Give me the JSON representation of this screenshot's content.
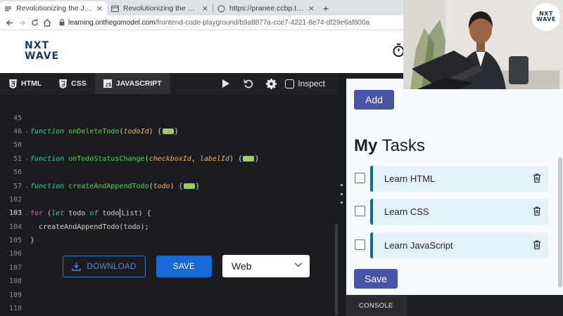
{
  "browser": {
    "tabs": [
      {
        "title": "Revolutionizing the Job M",
        "active": true
      },
      {
        "title": "Revolutionizing the Job M",
        "active": false
      },
      {
        "title": "https://pranee.ccbp.tech",
        "active": false
      }
    ],
    "url_host": "learning.onthegomodel.com",
    "url_path": "/frontend-code-playground/b9a8877a-cce7-4221-8e74-df29e6af800a"
  },
  "brand": {
    "line1": "NXT",
    "line2": "WAVE"
  },
  "editor": {
    "tabs": [
      {
        "label": "HTML",
        "icon": "html5-icon"
      },
      {
        "label": "CSS",
        "icon": "css3-icon"
      },
      {
        "label": "JAVASCRIPT",
        "icon": "js-icon"
      }
    ],
    "inspect_label": "Inspect",
    "line_numbers": {
      "l45": "45",
      "l46": "46",
      "l50": "50",
      "l51": "51",
      "l56": "56",
      "l57": "57",
      "l102": "102",
      "l103": "103",
      "l104": "104",
      "l105": "105",
      "l106": "106",
      "l107": "107",
      "l108": "108",
      "l109": "109",
      "l110": "110"
    },
    "tokens": {
      "function": "function",
      "onDeleteTodo": "onDeleteTodo",
      "todoId": "todoId",
      "onTodoStatusChange": "onTodoStatusChange",
      "checkboxId": "checkboxId",
      "labelId": "labelId",
      "createAndAppendTodo": "createAndAppendTodo",
      "todo": "todo",
      "for": "for",
      "let": "let",
      "of": "of",
      "todo_prefix": "todo",
      "todo_suffix": "List",
      "call_line": "createAndAppendTodo(todo);",
      "close_brace": "}"
    }
  },
  "actions": {
    "download_label": "DOWNLOAD",
    "save_label": "SAVE",
    "select_value": "Web"
  },
  "preview": {
    "add_label": "Add",
    "heading_bold": "My",
    "heading_rest": " Tasks",
    "tasks": [
      {
        "label": "Learn HTML",
        "checked": false
      },
      {
        "label": "Learn CSS",
        "checked": false
      },
      {
        "label": "Learn JavaScript",
        "checked": false
      }
    ],
    "save_label": "Save"
  },
  "console": {
    "label": "CONSOLE"
  },
  "webcam": {
    "logo_line1": "NXT",
    "logo_line2": "WAVE"
  }
}
